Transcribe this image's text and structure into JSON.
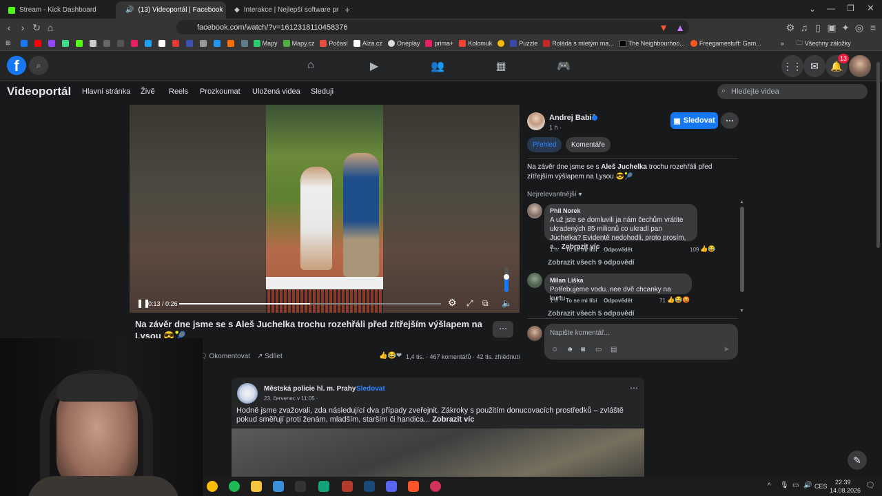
{
  "browser": {
    "tabs": [
      {
        "title": "Stream - Kick Dashboard",
        "active": false
      },
      {
        "title": "(13) Videoportál | Facebook",
        "active": true
      },
      {
        "title": "Interakce | Nejlepší software pro vyle",
        "active": false
      }
    ],
    "url": "facebook.com/watch/?v=1612318110458376",
    "bookmarks": [
      "Mapy",
      "Mapy.cz",
      "Počasí",
      "Alza.cz",
      "Oneplay",
      "prima+",
      "Kolomuk",
      "Puzzle",
      "Roláda s mletým ma...",
      "The Neighbourhoo...",
      "Freegamestuff: Gam..."
    ],
    "all_bookmarks": "Všechny záložky"
  },
  "fb": {
    "notifications_count": "13",
    "subnav": {
      "title": "Videoportál",
      "items": [
        "Hlavní stránka",
        "Živě",
        "Reels",
        "Prozkoumat",
        "Uložená videa",
        "Sleduji"
      ],
      "search_placeholder": "Hledejte videa"
    },
    "video": {
      "time": "0:13 / 0:26",
      "progress": 0.5,
      "title": "Na závěr dne jsme se s Aleš Juchelka trochu rozehřáli před zítřejším výšlapem na Lysou 😎🎾",
      "actions": {
        "comment": "Okomentovat",
        "share": "Sdílet"
      },
      "stats": "1,4 tis. · 467 komentářů · 42 tis. zhlédnutí"
    },
    "panel": {
      "author": "Andrej Babiš",
      "time": "1 h ·",
      "follow": "Sledovat",
      "tab_overview": "Přehled",
      "tab_comments": "Komentáře",
      "caption_pre": "Na závěr dne jsme se s ",
      "caption_bold": "Aleš Juchelka",
      "caption_post": " trochu rozehřáli před zítřejším výšlapem na Lysou 😎🎾",
      "sort": "Nejrelevantnější",
      "comments": [
        {
          "name": "Phil Norek",
          "text": "A už jste se domluvili ja nám čechům vrátite ukradených 85 milionů co ukradl pan Juchelka? Evidentě nedohodli, proto prosím, a...",
          "more": "Zobrazit víc",
          "time": "1 h",
          "like": "To se mi líbí",
          "reply": "Odpovědět",
          "reactions": "109",
          "view_replies": "Zobrazit všech 9 odpovědí"
        },
        {
          "name": "Milan Liška",
          "text": "Potřebujeme vodu..nee dvě chcanky na kurtu",
          "time": "1 h",
          "like": "To se mi líbí",
          "reply": "Odpovědět",
          "reactions": "71",
          "view_replies": "Zobrazit všech 5 odpovědí"
        }
      ],
      "comment_placeholder": "Napište komentář..."
    },
    "post": {
      "author": "Městská policie hl. m. Prahy",
      "follow": "Sledovat",
      "date": "23. červenec v 11:05 ·",
      "text": "Hodně jsme zvažovali, zda následující dva případy zveřejnit. Zákroky s použitím donucovacích prostředků – zvláště pokud směřují proti ženám, mladším, starším či handica...",
      "more": "Zobrazit víc"
    }
  },
  "taskbar": {
    "lang": "CES",
    "time": "22:39",
    "date": "14.08.2026"
  },
  "colors": {
    "accent": "#1877f2",
    "bg": "#18191a",
    "notif": "#e41e3f"
  }
}
